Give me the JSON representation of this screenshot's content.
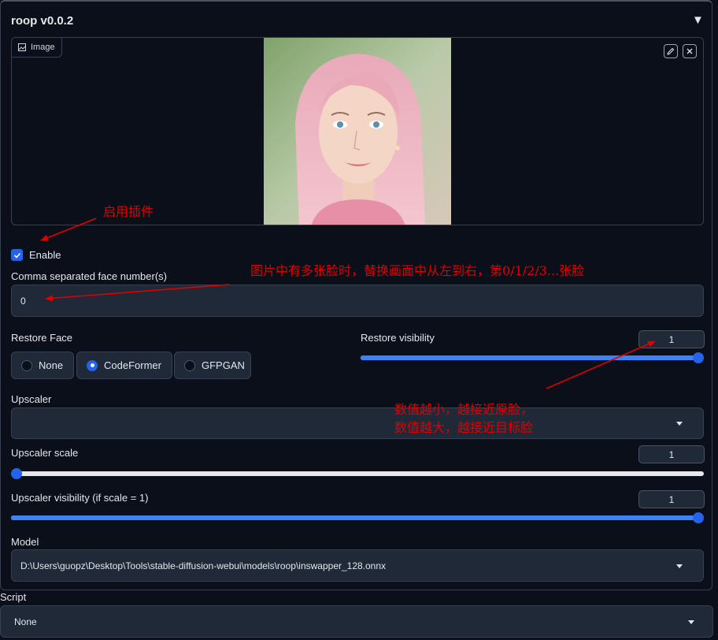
{
  "panel": {
    "title": "roop v0.0.2",
    "collapse_icon": "triangle-down-icon"
  },
  "image": {
    "label": "Image",
    "label_icon": "image-icon",
    "edit_icon": "pencil-icon",
    "clear_icon": "close-icon"
  },
  "enable": {
    "label": "Enable",
    "checked": true
  },
  "faces": {
    "label": "Comma separated face number(s)",
    "value": "0"
  },
  "restore_face": {
    "label": "Restore Face",
    "options": [
      "None",
      "CodeFormer",
      "GFPGAN"
    ],
    "selected": "CodeFormer"
  },
  "restore_visibility": {
    "label": "Restore visibility",
    "value": "1",
    "fraction": 1.0
  },
  "upscaler": {
    "label": "Upscaler",
    "value": ""
  },
  "upscaler_scale": {
    "label": "Upscaler scale",
    "value": "1",
    "fraction": 0.0
  },
  "upscaler_visibility": {
    "label": "Upscaler visibility (if scale = 1)",
    "value": "1",
    "fraction": 1.0
  },
  "model": {
    "label": "Model",
    "value": "D:\\Users\\guopz\\Desktop\\Tools\\stable-diffusion-webui\\models\\roop\\inswapper_128.onnx"
  },
  "script": {
    "label": "Script",
    "value": "None"
  },
  "annotations": {
    "enable_note": "启用插件",
    "faces_note": "图片中有多张脸时，替换画面中从左到右，第0/1/2/3...张脸",
    "visibility_note_1": "数值越小，越接近原脸，",
    "visibility_note_2": "数值越大，越接近目标脸"
  },
  "colors": {
    "background": "#0b0f19",
    "accent": "#2563eb",
    "annotation": "#e00000"
  }
}
